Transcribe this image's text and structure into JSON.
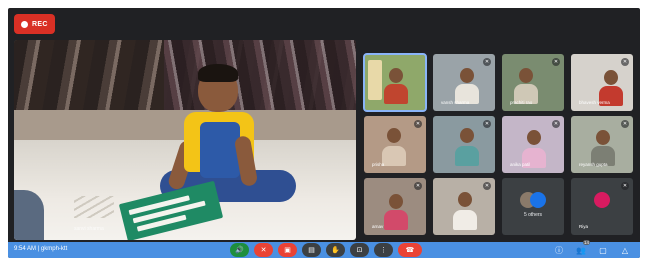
{
  "recording": {
    "label": "REC",
    "accent": "#d93025"
  },
  "main_speaker": {
    "name": "sanvi sharma"
  },
  "participants": [
    {
      "name": "",
      "active": true
    },
    {
      "name": "vansh sharma"
    },
    {
      "name": "prachiti rao"
    },
    {
      "name": "bhavesh verma"
    },
    {
      "name": "prisha"
    },
    {
      "name": ""
    },
    {
      "name": "anika patil"
    },
    {
      "name": "reyansh gupta"
    },
    {
      "name": "arnav"
    },
    {
      "name": ""
    },
    {
      "name": "5 others"
    },
    {
      "name": "Riya"
    }
  ],
  "control_bar": {
    "time_code": "9:54 AM | gkmph-ktt",
    "color": "#4a90e2",
    "buttons": [
      {
        "icon": "volume-icon",
        "glyph": "🔊"
      },
      {
        "icon": "mic-off-icon",
        "glyph": "✕"
      },
      {
        "icon": "camera-off-icon",
        "glyph": "▣"
      },
      {
        "icon": "captions-icon",
        "glyph": "▤"
      },
      {
        "icon": "raise-hand-icon",
        "glyph": "✋"
      },
      {
        "icon": "present-icon",
        "glyph": "⊡"
      },
      {
        "icon": "more-options-icon",
        "glyph": "⋮"
      },
      {
        "icon": "end-call-icon",
        "glyph": "☎"
      }
    ],
    "right_buttons": [
      {
        "icon": "info-icon",
        "glyph": "ⓘ"
      },
      {
        "icon": "people-icon",
        "glyph": "👥",
        "badge": "14"
      },
      {
        "icon": "chat-icon",
        "glyph": "▢"
      },
      {
        "icon": "activities-icon",
        "glyph": "△"
      }
    ]
  }
}
